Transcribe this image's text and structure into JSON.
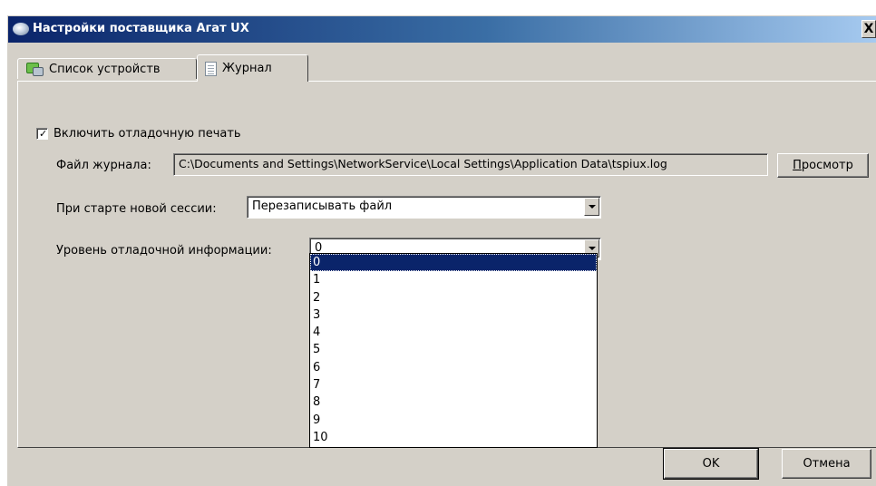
{
  "window": {
    "title": "Настройки поставщика Агат UX",
    "close_label": "X"
  },
  "tabs": [
    {
      "label": "Список устройств",
      "icon": "devices-icon",
      "active": false
    },
    {
      "label": "Журнал",
      "icon": "journal-icon",
      "active": true
    }
  ],
  "journal": {
    "debug_checkbox": {
      "label": "Включить отладочную печать",
      "checked": true
    },
    "log_file": {
      "label": "Файл журнала:",
      "value": "C:\\Documents and Settings\\NetworkService\\Local Settings\\Application Data\\tspiux.log",
      "browse_label_accel": "П",
      "browse_label_rest": "росмотр"
    },
    "session_start": {
      "label": "При старте новой сессии:",
      "value": "Перезаписывать файл"
    },
    "debug_level": {
      "label": "Уровень отладочной информации:",
      "value": "0",
      "options": [
        "0",
        "1",
        "2",
        "3",
        "4",
        "5",
        "6",
        "7",
        "8",
        "9",
        "10"
      ],
      "selected_index": 0
    }
  },
  "footer": {
    "ok_label": "OK",
    "cancel_label": "Отмена"
  },
  "colors": {
    "titlebar_start": "#0a246a",
    "titlebar_end": "#a6caf0",
    "face": "#d4d0c8",
    "selection": "#0a246a"
  }
}
